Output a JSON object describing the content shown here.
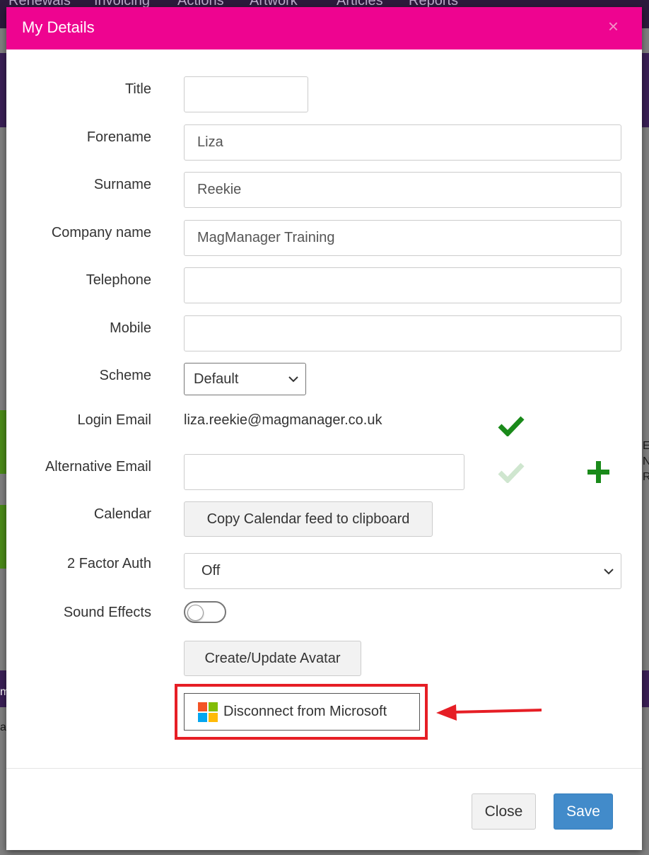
{
  "background_nav": [
    "Renewals",
    "Invoicing",
    "Actions",
    "Artwork",
    "Articles",
    "Reports"
  ],
  "background_snippets": [
    "E",
    "N",
    "R",
    "m",
    "ab"
  ],
  "modal": {
    "title": "My Details",
    "close_glyph": "×"
  },
  "form": {
    "title": {
      "label": "Title",
      "value": ""
    },
    "forename": {
      "label": "Forename",
      "value": "Liza"
    },
    "surname": {
      "label": "Surname",
      "value": "Reekie"
    },
    "company": {
      "label": "Company name",
      "value": "MagManager Training"
    },
    "telephone": {
      "label": "Telephone",
      "value": ""
    },
    "mobile": {
      "label": "Mobile",
      "value": ""
    },
    "scheme": {
      "label": "Scheme",
      "selected": "Default"
    },
    "login_email": {
      "label": "Login Email",
      "value": "liza.reekie@magmanager.co.uk",
      "verified_icon": "check-icon"
    },
    "alt_email": {
      "label": "Alternative Email",
      "value": "",
      "status_icon": "check-icon",
      "add_icon": "plus-icon"
    },
    "calendar": {
      "label": "Calendar",
      "button": "Copy Calendar feed to clipboard"
    },
    "two_factor": {
      "label": "2 Factor Auth",
      "selected": "Off"
    },
    "sound": {
      "label": "Sound Effects",
      "enabled": false
    },
    "avatar_button": "Create/Update Avatar",
    "microsoft_button": "Disconnect from Microsoft"
  },
  "footer": {
    "close": "Close",
    "save": "Save"
  },
  "colors": {
    "header": "#ee0490",
    "save": "#428bca",
    "check_green": "#1a8a1a",
    "check_faded": "#cfe6cf",
    "plus_green": "#1a8a1a",
    "annotation_red": "#e61e25",
    "ms_red": "#f35325",
    "ms_green": "#81bc06",
    "ms_blue": "#05a6f0",
    "ms_yellow": "#ffba08"
  }
}
